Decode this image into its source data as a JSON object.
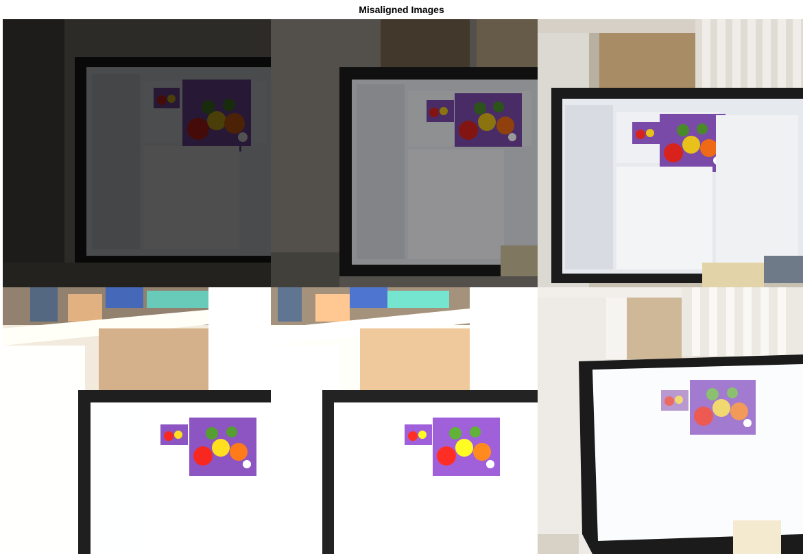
{
  "figure": {
    "title": "Misaligned Images"
  },
  "colors": {
    "purple": "#7a4aa8",
    "red": "#d8231c",
    "yellow": "#e8c21b",
    "green": "#4a8a2a",
    "orange": "#ee6a16"
  },
  "tiles": [
    {
      "exposure": "very dark",
      "brightness": 0.32
    },
    {
      "exposure": "dark",
      "brightness": 0.6
    },
    {
      "exposure": "normal",
      "brightness": 1.0
    },
    {
      "exposure": "bright",
      "brightness": 1.15
    },
    {
      "exposure": "very bright",
      "brightness": 1.3
    },
    {
      "exposure": "overexposed",
      "brightness": 1.6
    }
  ]
}
